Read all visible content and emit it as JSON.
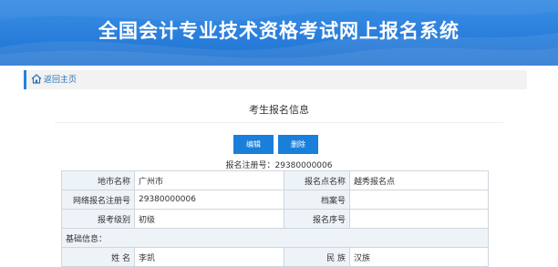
{
  "header": {
    "title": "全国会计专业技术资格考试网上报名系统"
  },
  "breadcrumb": {
    "home_label": "返回主页"
  },
  "page": {
    "section_title": "考生报名信息",
    "edit_label": "编辑",
    "delete_label": "删除",
    "reg_line": "报名注册号：29380000006"
  },
  "table": {
    "rows": [
      {
        "l1": "地市名称",
        "v1": "广州市",
        "l2": "报名点名称",
        "v2": "越秀报名点"
      },
      {
        "l1": "网络报名注册号",
        "v1": "29380000006",
        "l2": "档案号",
        "v2": ""
      },
      {
        "l1": "报考级别",
        "v1": "初级",
        "l2": "报名序号",
        "v2": ""
      }
    ],
    "section_basic": "基础信息：",
    "basic_row": {
      "l1": "姓 名",
      "v1": "李凯",
      "l2": "民 族",
      "v2": "汉族"
    }
  },
  "colors": {
    "header_blue": "#2a7fdc",
    "button_blue": "#1a7fdb",
    "label_bg": "#eef3f8"
  }
}
